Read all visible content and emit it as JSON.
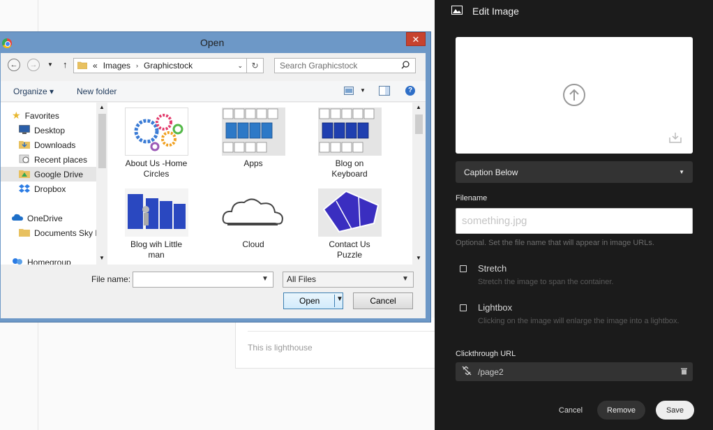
{
  "background": {
    "caption": "This is lighthouse"
  },
  "panel": {
    "title": "Edit Image",
    "caption_select": "Caption Below",
    "filename_label": "Filename",
    "filename_placeholder": "something.jpg",
    "filename_hint": "Optional. Set the file name that will appear in image URLs.",
    "stretch_label": "Stretch",
    "stretch_desc": "Stretch the image to span the container.",
    "lightbox_label": "Lightbox",
    "lightbox_desc": "Clicking on the image will enlarge the image into a lightbox.",
    "url_label": "Clickthrough URL",
    "url_value": "/page2",
    "cancel": "Cancel",
    "remove": "Remove",
    "save": "Save"
  },
  "dialog": {
    "title": "Open",
    "close": "✕",
    "path": {
      "prefix": "«",
      "parts": [
        "Images",
        "Graphicstock"
      ]
    },
    "search_placeholder": "Search Graphicstock",
    "organize": "Organize ▾",
    "new_folder": "New folder",
    "nav": [
      {
        "label": "Favorites",
        "icon": "star-icon"
      },
      {
        "label": "Desktop",
        "icon": "desktop-icon"
      },
      {
        "label": "Downloads",
        "icon": "folder-icon"
      },
      {
        "label": "Recent places",
        "icon": "recent-places-icon"
      },
      {
        "label": "Google Drive",
        "icon": "folder-icon"
      },
      {
        "label": "Dropbox",
        "icon": "dropbox-icon"
      },
      {
        "label": "OneDrive",
        "icon": "cloud-icon"
      },
      {
        "label": "Documents Sky D",
        "icon": "folder-icon"
      },
      {
        "label": "Homegroup",
        "icon": "homegroup-icon"
      }
    ],
    "files": [
      {
        "line1": "About Us -Home",
        "line2": "Circles"
      },
      {
        "line1": "Apps",
        "line2": ""
      },
      {
        "line1": "Blog on",
        "line2": "Keyboard"
      },
      {
        "line1": "Blog wih Little",
        "line2": "man"
      },
      {
        "line1": "Cloud",
        "line2": ""
      },
      {
        "line1": "Contact Us",
        "line2": "Puzzle"
      }
    ],
    "file_name_label": "File name:",
    "file_name_value": "",
    "file_type": "All Files",
    "open_btn": "Open",
    "cancel_btn": "Cancel"
  }
}
